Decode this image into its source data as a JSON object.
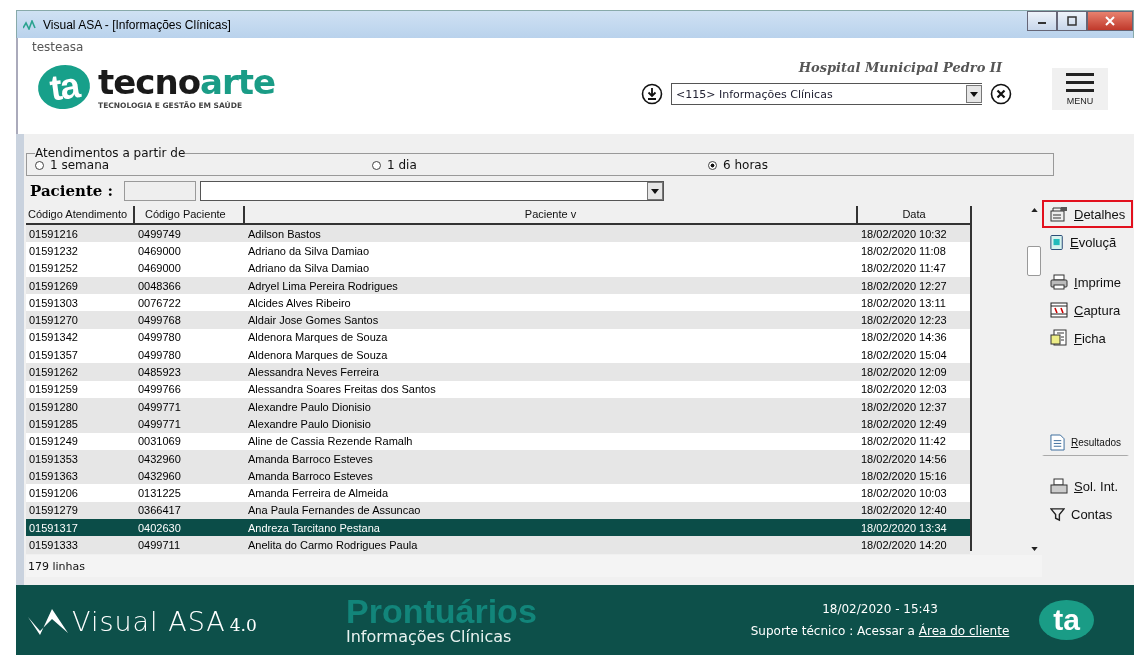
{
  "window": {
    "title": "Visual ASA - [Informações Clínicas]"
  },
  "header": {
    "user": "testeasa",
    "logo": {
      "mark": "ta",
      "name_dark": "tecno",
      "name_accent": "arte",
      "tagline": "TECNOLOGIA E GESTÃO EM SAÚDE"
    },
    "hospital": "Hospital Municipal Pedro II",
    "module_select": {
      "value": "<115> Informações Clínicas"
    },
    "menu_label": "MENU"
  },
  "filter": {
    "legend": "Atendimentos a partir de",
    "options": [
      {
        "label": "1 semana",
        "selected": false
      },
      {
        "label": "1 dia",
        "selected": false
      },
      {
        "label": "6 horas",
        "selected": true
      }
    ]
  },
  "patient_search": {
    "label": "Paciente :"
  },
  "table": {
    "columns": [
      "Código Atendimento",
      "Código Paciente",
      "Paciente v",
      "Data"
    ],
    "rows": [
      {
        "cells": [
          "01591216",
          "0499749",
          "Adilson Bastos",
          "18/02/2020 10:32"
        ],
        "shaded": true,
        "selected": false
      },
      {
        "cells": [
          "01591232",
          "0469000",
          "Adriano da Silva Damiao",
          "18/02/2020 11:08"
        ],
        "shaded": false,
        "selected": false
      },
      {
        "cells": [
          "01591252",
          "0469000",
          "Adriano da Silva Damiao",
          "18/02/2020 11:47"
        ],
        "shaded": false,
        "selected": false
      },
      {
        "cells": [
          "01591269",
          "0048366",
          "Adryel Lima Pereira Rodrigues",
          "18/02/2020 12:27"
        ],
        "shaded": true,
        "selected": false
      },
      {
        "cells": [
          "01591303",
          "0076722",
          "Alcides Alves Ribeiro",
          "18/02/2020 13:11"
        ],
        "shaded": false,
        "selected": false
      },
      {
        "cells": [
          "01591270",
          "0499768",
          "Aldair Jose Gomes Santos",
          "18/02/2020 12:23"
        ],
        "shaded": true,
        "selected": false
      },
      {
        "cells": [
          "01591342",
          "0499780",
          "Aldenora Marques de Souza",
          "18/02/2020 14:36"
        ],
        "shaded": false,
        "selected": false
      },
      {
        "cells": [
          "01591357",
          "0499780",
          "Aldenora Marques de Souza",
          "18/02/2020 15:04"
        ],
        "shaded": false,
        "selected": false
      },
      {
        "cells": [
          "01591262",
          "0485923",
          "Alessandra Neves Ferreira",
          "18/02/2020 12:09"
        ],
        "shaded": true,
        "selected": false
      },
      {
        "cells": [
          "01591259",
          "0499766",
          "Alessandra Soares Freitas dos Santos",
          "18/02/2020 12:03"
        ],
        "shaded": false,
        "selected": false
      },
      {
        "cells": [
          "01591280",
          "0499771",
          "Alexandre Paulo Dionisio",
          "18/02/2020 12:37"
        ],
        "shaded": true,
        "selected": false
      },
      {
        "cells": [
          "01591285",
          "0499771",
          "Alexandre Paulo Dionisio",
          "18/02/2020 12:49"
        ],
        "shaded": true,
        "selected": false
      },
      {
        "cells": [
          "01591249",
          "0031069",
          "Aline de Cassia Rezende Ramalh",
          "18/02/2020 11:42"
        ],
        "shaded": false,
        "selected": false
      },
      {
        "cells": [
          "01591353",
          "0432960",
          "Amanda Barroco Esteves",
          "18/02/2020 14:56"
        ],
        "shaded": true,
        "selected": false
      },
      {
        "cells": [
          "01591363",
          "0432960",
          "Amanda Barroco Esteves",
          "18/02/2020 15:16"
        ],
        "shaded": true,
        "selected": false
      },
      {
        "cells": [
          "01591206",
          "0131225",
          "Amanda Ferreira de Almeida",
          "18/02/2020 10:03"
        ],
        "shaded": false,
        "selected": false
      },
      {
        "cells": [
          "01591279",
          "0366417",
          "Ana Paula Fernandes de Assuncao",
          "18/02/2020 12:40"
        ],
        "shaded": true,
        "selected": false
      },
      {
        "cells": [
          "01591317",
          "0402630",
          "Andreza Tarcitano Pestana",
          "18/02/2020 13:34"
        ],
        "shaded": false,
        "selected": true
      },
      {
        "cells": [
          "01591333",
          "0499711",
          "Anelita do Carmo Rodrigues Paula",
          "18/02/2020 14:20"
        ],
        "shaded": true,
        "selected": false
      }
    ]
  },
  "actions": [
    {
      "label": "Detalhes",
      "kind": "details",
      "highlighted": true
    },
    {
      "label": "Evoluçã",
      "kind": "evolution",
      "highlighted": false
    },
    {
      "label": "Imprime",
      "kind": "print",
      "highlighted": false
    },
    {
      "label": "Captura",
      "kind": "capture",
      "highlighted": false
    },
    {
      "label": "Ficha",
      "kind": "form",
      "highlighted": false
    },
    {
      "label": "Resultados",
      "kind": "results",
      "highlighted": false
    },
    {
      "label": "Sol. Int.",
      "kind": "request",
      "highlighted": false
    },
    {
      "label": "Contas",
      "kind": "filter",
      "highlighted": false
    }
  ],
  "status": {
    "row_count": "179 linhas"
  },
  "footer": {
    "brand": "Visual ASA",
    "version": "4.0",
    "title": "Prontuários",
    "subtitle": "Informações Clínicas",
    "datetime": "18/02/2020 - 15:43",
    "support": "Suporte técnico : Acessar a ",
    "support_link": "Área do cliente",
    "mark": "ta"
  }
}
